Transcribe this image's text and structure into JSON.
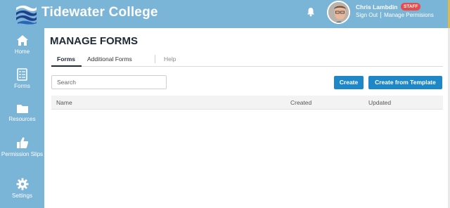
{
  "header": {
    "brand": "Tidewater College",
    "user": {
      "name": "Chris Lambdin",
      "badge": "STAFF",
      "sign_out": "Sign Out",
      "manage_permissions": "Manage Permisions"
    },
    "colors": {
      "bar": "#7ab4d6",
      "badge": "#e74c4c"
    },
    "icons": {
      "logo": "waves-logo-icon",
      "notifications": "bell-icon"
    }
  },
  "sidebar": {
    "items": [
      {
        "label": "Home",
        "icon": "home-icon"
      },
      {
        "label": "Forms",
        "icon": "forms-icon"
      },
      {
        "label": "Resources",
        "icon": "folder-icon"
      },
      {
        "label": "Permission Slips",
        "icon": "thumbs-up-icon"
      },
      {
        "label": "Settings",
        "icon": "gear-icon"
      }
    ]
  },
  "main": {
    "title": "MANAGE FORMS",
    "tabs": [
      {
        "label": "Forms",
        "active": true
      },
      {
        "label": "Additional Forms",
        "active": false
      },
      {
        "label": "Help",
        "active": false
      }
    ],
    "search": {
      "placeholder": "Search",
      "value": ""
    },
    "buttons": {
      "create": "Create",
      "create_from_template": "Create from Template"
    },
    "table": {
      "columns": [
        "Name",
        "Created",
        "Updated"
      ],
      "rows": []
    },
    "colors": {
      "primary_button": "#1e87c8"
    }
  }
}
